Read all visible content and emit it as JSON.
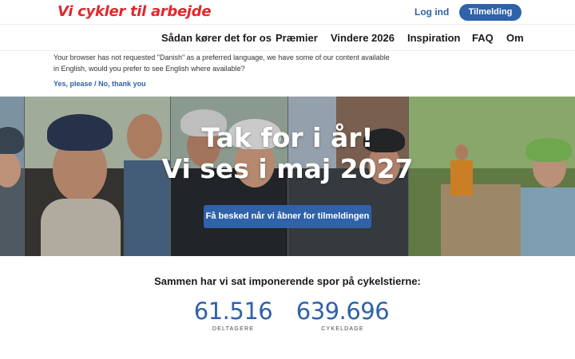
{
  "header": {
    "logo": "Vi cykler til arbejde",
    "login_label": "Log ind",
    "signup_label": "Tilmelding"
  },
  "nav": {
    "items": [
      {
        "label": "Sådan kører det for os"
      },
      {
        "label": "Præmier"
      },
      {
        "label": "Vindere 2026"
      },
      {
        "label": "Inspiration"
      },
      {
        "label": "FAQ"
      },
      {
        "label": "Om"
      }
    ]
  },
  "language_notice": {
    "text": "Your browser has not requested \"Danish\" as a preferred language, we have some of our content available in English, would you prefer to see English where available?",
    "yes_label": "Yes, please",
    "separator": " / ",
    "no_label": "No, thank you"
  },
  "hero": {
    "title_line1": "Tak for i år!",
    "title_line2": "Vi ses i maj 2027",
    "button_label": "Få besked når vi åbner for tilmeldingen"
  },
  "stats": {
    "heading": "Sammen har vi sat imponerende spor på cykelstierne:",
    "items": [
      {
        "value": "61.516",
        "label": "DELTAGERE"
      },
      {
        "value": "639.696",
        "label": "CYKELDAGE"
      }
    ]
  },
  "colors": {
    "brand_red": "#e3262b",
    "brand_blue": "#2f62a8"
  }
}
